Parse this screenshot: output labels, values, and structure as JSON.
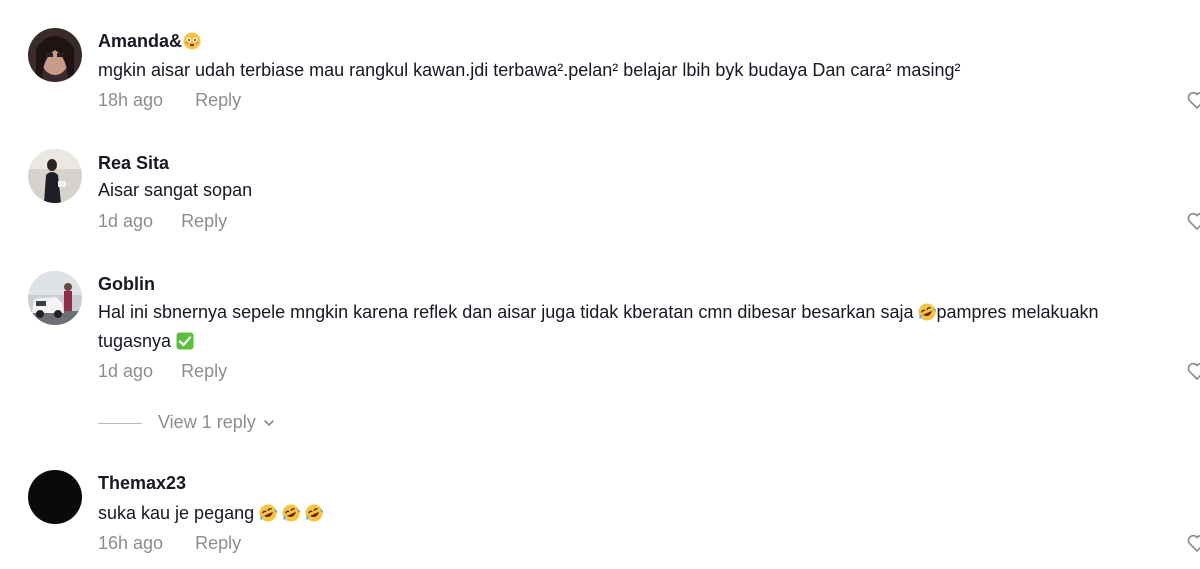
{
  "comments": [
    {
      "username": "Amanda&",
      "username_emoji": "flushed-face-emoji",
      "text": "mgkin aisar udah terbiase mau rangkul kawan.jdi terbawa².pelan² belajar lbih byk budaya Dan cara² masing²",
      "time": "18h ago",
      "reply": "Reply"
    },
    {
      "username": "Rea Sita",
      "text": "Aisar sangat sopan",
      "time": "1d ago",
      "reply": "Reply"
    },
    {
      "username": "Goblin",
      "text_line1": "Hal ini sbnernya sepele mngkin karena reflek dan aisar juga tidak kberatan cmn dibesar besarkan saja",
      "text_line1_tail": "pampres melakuakn",
      "text_line2": "tugasnya",
      "time": "1d ago",
      "reply": "Reply",
      "view_replies": "View 1 reply"
    },
    {
      "username": "Themax23",
      "text": "suka kau je pegang",
      "time": "16h ago",
      "reply": "Reply"
    }
  ],
  "icons": {
    "like": "heart-outline-icon",
    "laughing_emoji": "rolling-on-floor-laughing-emoji",
    "check_emoji": "check-mark-button-emoji",
    "chevron": "chevron-down-icon"
  },
  "colors": {
    "text_primary": "#161823",
    "text_secondary": "rgba(22,24,35,0.5)"
  }
}
